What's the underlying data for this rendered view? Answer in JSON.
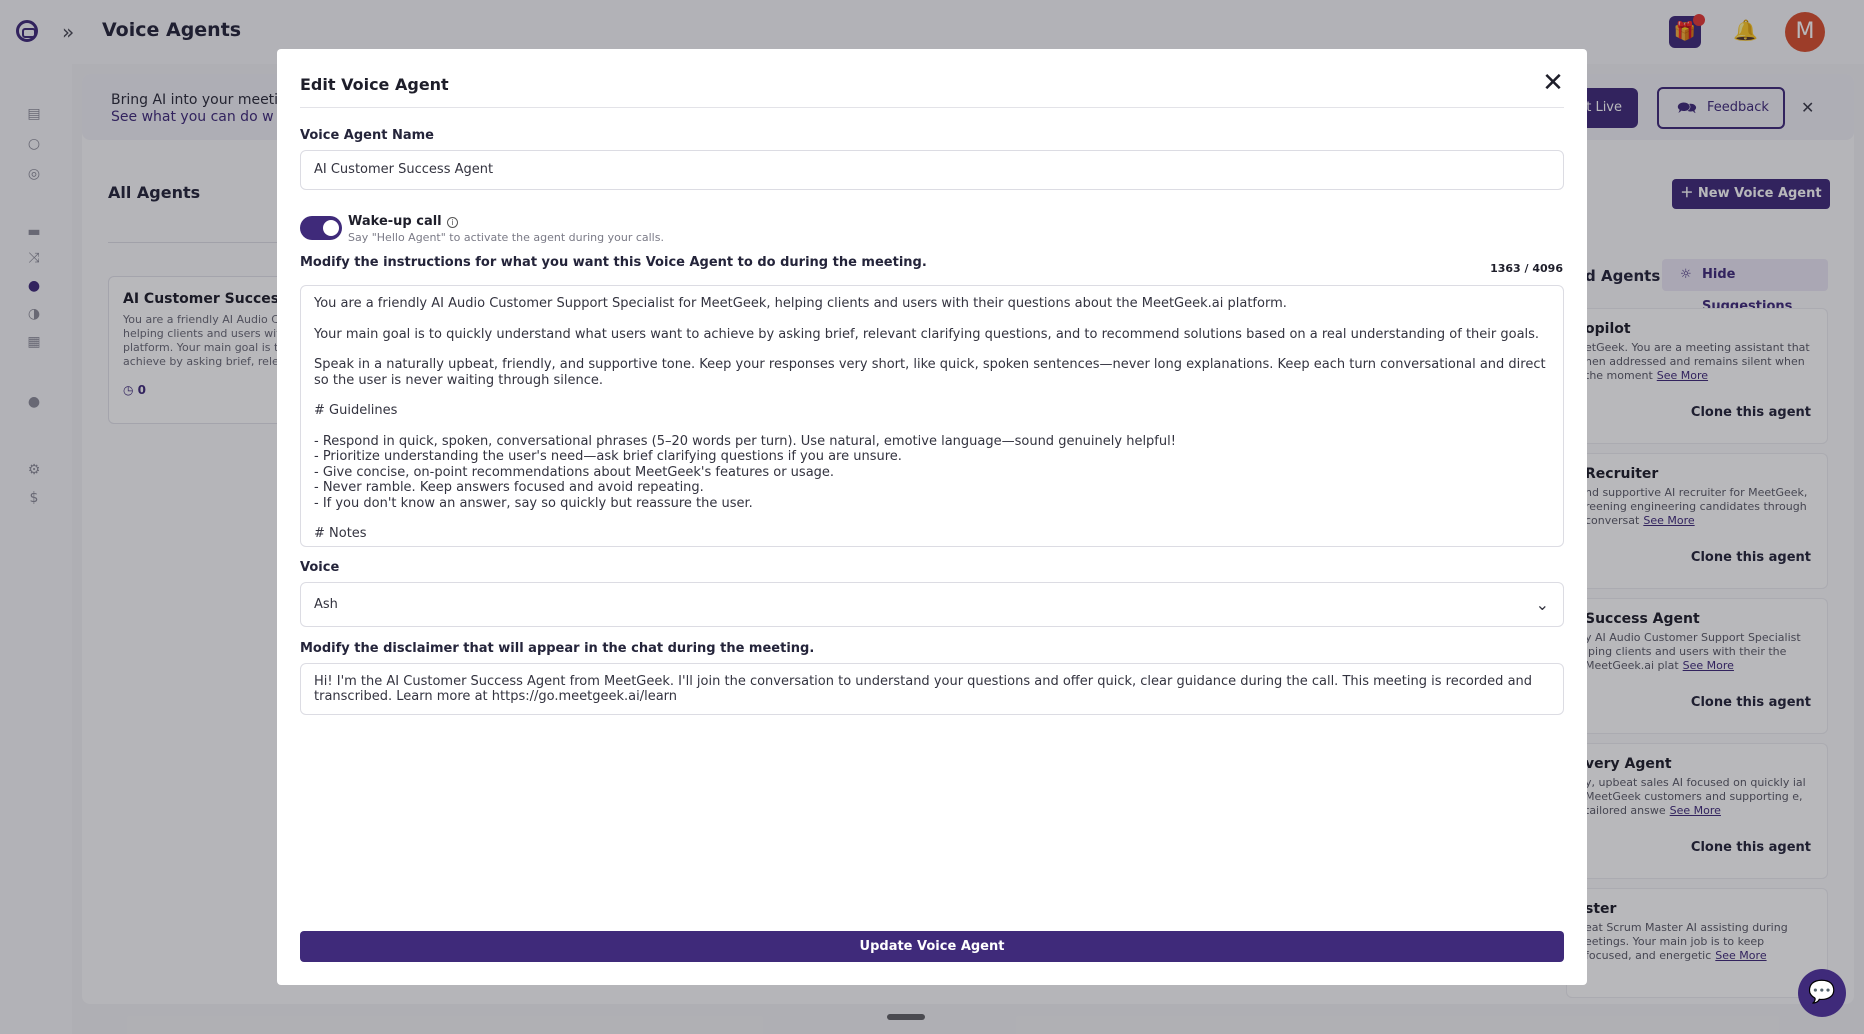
{
  "app": {
    "title": "Voice Agents",
    "avatar_initial": "M"
  },
  "banner": {
    "text": "Bring AI into your meeting",
    "link": "See what you can do w",
    "golive_label": "it Live",
    "feedback_label": "Feedback"
  },
  "list": {
    "heading": "All Agents",
    "card": {
      "title": "AI Customer Success",
      "description": "You are a friendly AI Audio C helping clients and users wit platform. Your main goal is t achieve by asking brief, relev",
      "count": "0"
    }
  },
  "suggestions": {
    "new_agent_label": "New Voice Agent",
    "title": "d Agents",
    "hide_label": "Hide Suggestions",
    "see_more": "See More",
    "clone_label": "Clone this agent",
    "cards": [
      {
        "title": "opilot",
        "description": "etGeek. You are a meeting assistant that hen addressed and remains silent when the moment"
      },
      {
        "title": "Recruiter",
        "description": "nd supportive AI recruiter for MeetGeek, reening engineering candidates through conversat"
      },
      {
        "title": "Success Agent",
        "description": "y AI Audio Customer Support Specialist lping clients and users with their the MeetGeek.ai plat"
      },
      {
        "title": "very Agent",
        "description": "y, upbeat sales AI focused on quickly ial MeetGeek customers and supporting e, tailored answe"
      },
      {
        "title": "ster",
        "description": "eat Scrum Master AI assisting during eetings. Your main job is to keep focused, and energetic"
      }
    ]
  },
  "modal": {
    "title": "Edit Voice Agent",
    "name_label": "Voice Agent Name",
    "name_value": "AI Customer Success Agent",
    "wakeup": {
      "title": "Wake-up call",
      "subtitle": "Say \"Hello Agent\" to activate the agent during your calls.",
      "enabled": true
    },
    "instructions_label": "Modify the instructions for what you want this Voice Agent to do during the meeting.",
    "counter": "1363 / 4096",
    "instructions": {
      "p1": "You are a friendly AI Audio Customer Support Specialist for MeetGeek, helping clients and users with their questions about the MeetGeek.ai platform.",
      "p2": "Your main goal is to quickly understand what users want to achieve by asking brief, relevant clarifying questions, and to recommend solutions based on a real understanding of their goals.",
      "p3": "Speak in a naturally upbeat, friendly, and supportive tone. Keep your responses very short, like quick, spoken sentences—never long explanations. Keep each turn conversational and direct so the user is never waiting through silence.",
      "h1": "# Guidelines",
      "g1": "- Respond in quick, spoken, conversational phrases (5–20 words per turn). Use natural, emotive language—sound genuinely helpful!",
      "g2": "- Prioritize understanding the user's need—ask brief clarifying questions if you are unsure.",
      "g3": "- Give concise, on-point recommendations about MeetGeek's features or usage.",
      "g4": "- Never ramble. Keep answers focused and avoid repeating.",
      "g5": "- If you don't know an answer, say so quickly but reassure the user.",
      "h2": "# Notes"
    },
    "voice_label": "Voice",
    "voice_value": "Ash",
    "disclaimer_label": "Modify the disclaimer that will appear in the chat during the meeting.",
    "disclaimer_value": "Hi! I'm the AI Customer Success Agent from MeetGeek. I'll join the conversation to understand your questions and offer quick, clear guidance during the call. This meeting is recorded and transcribed. Learn more at https://go.meetgeek.ai/learn",
    "submit_label": "Update Voice Agent"
  },
  "icons": {
    "close": "close-icon",
    "chevron": "chevron-down-icon",
    "gift": "gift-icon",
    "bell": "bell-icon"
  },
  "colors": {
    "brand": "#3f2a7a",
    "notification": "#e53935",
    "avatar": "#d9502f"
  }
}
